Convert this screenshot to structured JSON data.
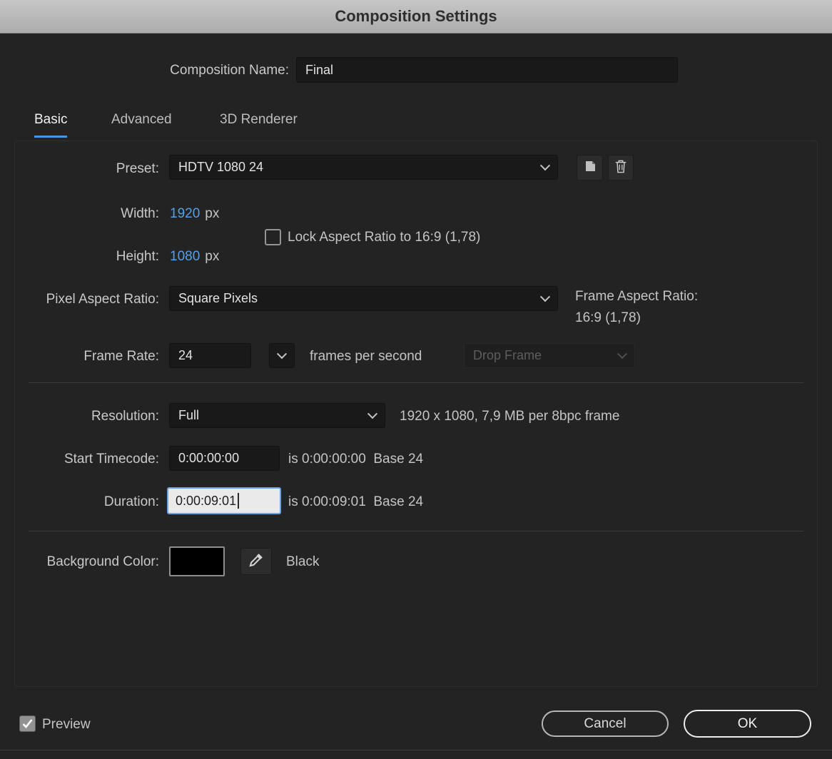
{
  "window": {
    "title": "Composition Settings"
  },
  "composition_name": {
    "label": "Composition Name:",
    "value": "Final"
  },
  "tabs": [
    {
      "label": "Basic"
    },
    {
      "label": "Advanced"
    },
    {
      "label": "3D Renderer"
    }
  ],
  "preset": {
    "label": "Preset:",
    "value": "HDTV 1080 24"
  },
  "dimensions": {
    "width_label": "Width:",
    "width_value": "1920",
    "height_label": "Height:",
    "height_value": "1080",
    "unit": "px",
    "lock_label": "Lock Aspect Ratio to 16:9 (1,78)",
    "lock_checked": false
  },
  "pixel_aspect": {
    "label": "Pixel Aspect Ratio:",
    "value": "Square Pixels"
  },
  "frame_aspect": {
    "label": "Frame Aspect Ratio:",
    "value": "16:9 (1,78)"
  },
  "frame_rate": {
    "label": "Frame Rate:",
    "value": "24",
    "suffix": "frames per second",
    "drop_frame_value": "Drop Frame",
    "drop_frame_enabled": false
  },
  "resolution": {
    "label": "Resolution:",
    "value": "Full",
    "info": "1920 x 1080, 7,9 MB per 8bpc frame"
  },
  "start_timecode": {
    "label": "Start Timecode:",
    "value": "0:00:00:00",
    "info": "is 0:00:00:00  Base 24"
  },
  "duration": {
    "label": "Duration:",
    "value": "0:00:09:01",
    "info": "is 0:00:09:01  Base 24"
  },
  "background_color": {
    "label": "Background Color:",
    "color_name": "Black",
    "swatch_hex": "#000000"
  },
  "footer": {
    "preview_label": "Preview",
    "preview_checked": true,
    "cancel_label": "Cancel",
    "ok_label": "OK"
  },
  "icons": {
    "dropdown": "chevron-down-icon",
    "preset_save": "save-preset-icon",
    "preset_delete": "trash-icon",
    "background_picker": "eyedropper-icon",
    "checkbox_check": "check-icon"
  },
  "colors": {
    "accent_blue": "#4696e0",
    "value_blue": "#55a0e6",
    "dialog_bg": "#232323",
    "titlebar_gray": "#b9b9b9"
  }
}
